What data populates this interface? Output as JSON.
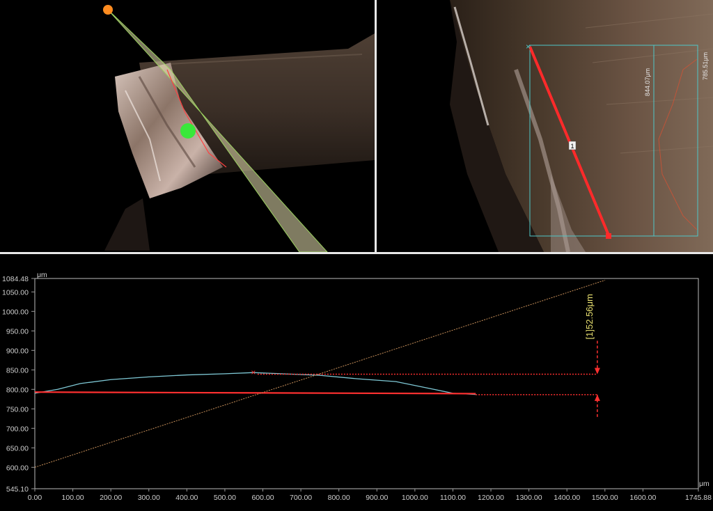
{
  "view2d": {
    "line_marker": "1",
    "box_label_1": "844.07μm",
    "box_label_2": "785.51μm"
  },
  "chart_data": {
    "type": "line",
    "y_unit": "μm",
    "x_unit": "μm",
    "xlim": [
      0.0,
      1745.88
    ],
    "ylim": [
      545.1,
      1084.48
    ],
    "x_ticks": [
      "0.00",
      "100.00",
      "200.00",
      "300.00",
      "400.00",
      "500.00",
      "600.00",
      "700.00",
      "800.00",
      "900.00",
      "1000.00",
      "1100.00",
      "1200.00",
      "1300.00",
      "1400.00",
      "1500.00",
      "1600.00",
      "1745.88"
    ],
    "y_ticks": [
      "545.10",
      "600.00",
      "650.00",
      "700.00",
      "750.00",
      "800.00",
      "850.00",
      "900.00",
      "950.00",
      "1000.00",
      "1050.00",
      "1084.48"
    ],
    "measurement_label": "[1]52.56μm",
    "series": [
      {
        "role": "surface profile",
        "color": "#7fc9d6",
        "x": [
          0,
          60,
          120,
          200,
          300,
          400,
          500,
          575,
          650,
          750,
          850,
          950,
          1050,
          1100,
          1160
        ],
        "y": [
          790,
          800,
          815,
          825,
          832,
          837,
          840,
          843,
          840,
          836,
          827,
          820,
          800,
          790,
          787
        ]
      },
      {
        "role": "reference line",
        "color": "#ff3030",
        "x": [
          0,
          1160
        ],
        "y": [
          793,
          789
        ]
      },
      {
        "role": "inclined line",
        "color": "#c8905a",
        "x": [
          0,
          1500
        ],
        "y": [
          600,
          1080
        ]
      }
    ],
    "markers": [
      {
        "x": 575,
        "y": 843,
        "symbol": "x",
        "color": "#ff3030"
      }
    ],
    "measurement": {
      "upper_y": 839,
      "lower_y": 786.5,
      "at_x": 1480,
      "color": "#ff3030",
      "label_color": "#e8e070"
    }
  }
}
